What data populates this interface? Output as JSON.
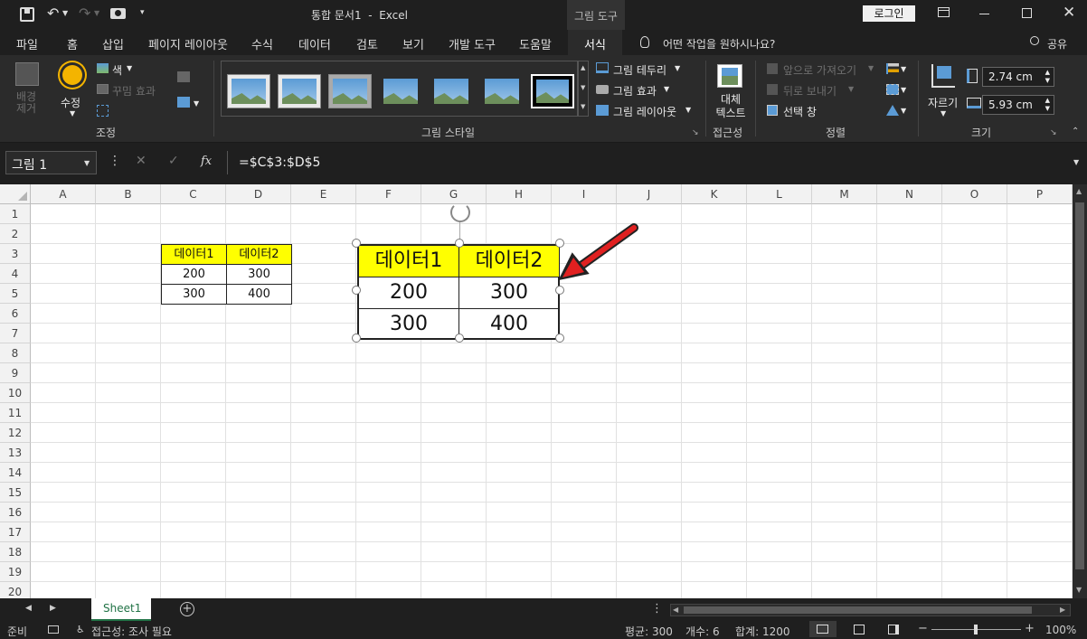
{
  "titlebar": {
    "doc_title": "통합 문서1  -  Excel",
    "context_tab": "그림 도구",
    "login": "로그인",
    "undo_icon": "undo-icon",
    "redo_icon": "redo-icon"
  },
  "menu": {
    "items": [
      "파일",
      "홈",
      "삽입",
      "페이지 레이아웃",
      "수식",
      "데이터",
      "검토",
      "보기",
      "개발 도구",
      "도움말",
      "서식"
    ],
    "active": "서식",
    "tell_me": "어떤 작업을 원하시나요?",
    "share": "공유"
  },
  "ribbon": {
    "adjust": {
      "remove_bg": "배경\n제거",
      "corrections": "수정",
      "color": "색",
      "artistic": "꾸밈 효과",
      "label": "조정"
    },
    "styles": {
      "border": "그림 테두리",
      "effects": "그림 효과",
      "layout": "그림 레이아웃",
      "label": "그림 스타일"
    },
    "accessibility": {
      "alt_text": "대체\n텍스트",
      "label": "접근성"
    },
    "arrange": {
      "bring_forward": "앞으로 가져오기",
      "send_backward": "뒤로 보내기",
      "selection_pane": "선택 창",
      "label": "정렬"
    },
    "size": {
      "crop": "자르기",
      "height": "2.74 cm",
      "width": "5.93 cm",
      "label": "크기"
    }
  },
  "formula": {
    "name_box": "그림 1",
    "fx": "fx",
    "value": "=$C$3:$D$5"
  },
  "grid": {
    "columns": [
      "A",
      "B",
      "C",
      "D",
      "E",
      "F",
      "G",
      "H",
      "I",
      "J",
      "K",
      "L",
      "M",
      "N",
      "O",
      "P"
    ],
    "rows": [
      "1",
      "2",
      "3",
      "4",
      "5",
      "6",
      "7",
      "8",
      "9",
      "10",
      "11",
      "12",
      "13",
      "14",
      "15",
      "16",
      "17",
      "18",
      "19",
      "20"
    ]
  },
  "table": {
    "header": [
      "데이터1",
      "데이터2"
    ],
    "rows": [
      [
        "200",
        "300"
      ],
      [
        "300",
        "400"
      ]
    ],
    "header_color": "#ffff00"
  },
  "picture": {
    "header": [
      "데이터1",
      "데이터2"
    ],
    "rows": [
      [
        "200",
        "300"
      ],
      [
        "300",
        "400"
      ]
    ]
  },
  "arrow_color": "#e02020",
  "sheets": {
    "tabs": [
      "Sheet1"
    ]
  },
  "status": {
    "ready": "준비",
    "accessibility": "접근성: 조사 필요",
    "average": "평균: 300",
    "count": "개수: 6",
    "sum": "합계: 1200",
    "zoom": "100%"
  }
}
